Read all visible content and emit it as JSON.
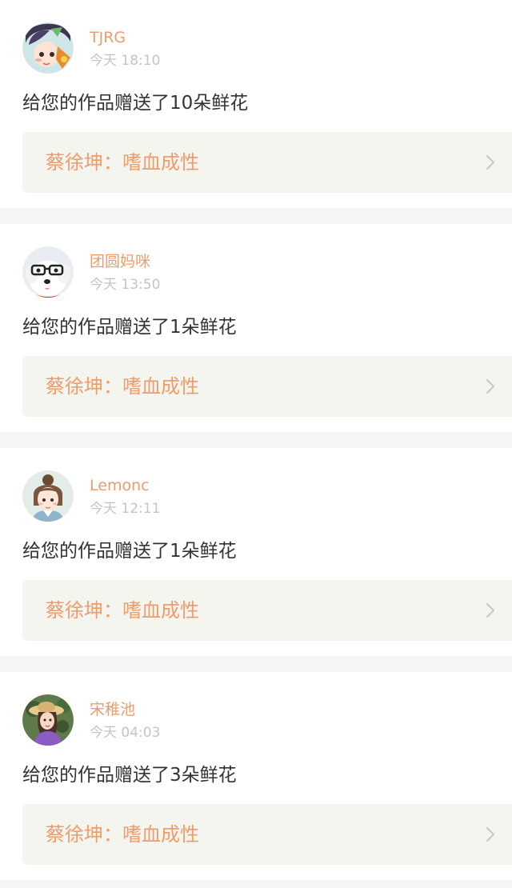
{
  "colors": {
    "accent": "#ee9c6b",
    "timestamp": "#c4c4c4",
    "message_text": "#333333",
    "link_card_background": "#f5f5ef",
    "page_background": "#f5f5f5",
    "chevron": "#c8c8c8"
  },
  "notifications": [
    {
      "username": "TJRG",
      "time": "今天 18:10",
      "message": "给您的作品赠送了10朵鲜花",
      "work_title": "蔡徐坤：嗜血成性",
      "avatar_icon": "anime-character-avatar-icon"
    },
    {
      "username": "团圆妈咪",
      "time": "今天 13:50",
      "message": "给您的作品赠送了1朵鲜花",
      "work_title": "蔡徐坤：嗜血成性",
      "avatar_icon": "dog-with-glasses-avatar-icon"
    },
    {
      "username": "Lemonc",
      "time": "今天 12:11",
      "message": "给您的作品赠送了1朵鲜花",
      "work_title": "蔡徐坤：嗜血成性",
      "avatar_icon": "illustrated-girl-avatar-icon"
    },
    {
      "username": "宋稚池",
      "time": "今天 04:03",
      "message": "给您的作品赠送了3朵鲜花",
      "work_title": "蔡徐坤：嗜血成性",
      "avatar_icon": "girl-in-straw-hat-avatar-icon"
    }
  ]
}
